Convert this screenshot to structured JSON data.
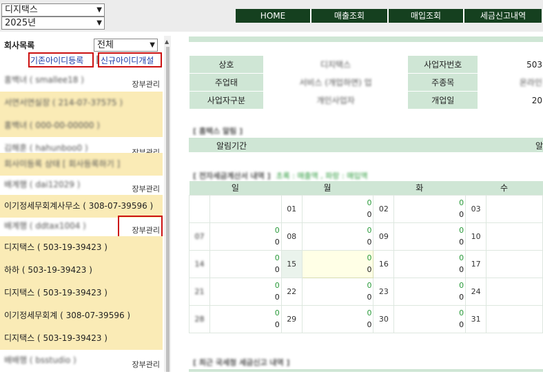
{
  "top": {
    "company_select": "디지택스",
    "year_select": "2025년",
    "nav": [
      "HOME",
      "매출조회",
      "매입조회",
      "세금신고내역"
    ]
  },
  "left": {
    "title": "회사목록",
    "filter": "전체",
    "btn_existing": "기존아이디등록",
    "sep": "|",
    "btn_new": "신규아이디개설",
    "mgmt_label": "장부관리",
    "rows": [
      "홍백녀 ( smallee18 )",
      "서연서연실장 ( 214-07-37575 )",
      "홍백녀 ( 000-00-00000 )",
      "김해훈 ( hahunboo0 )",
      "회사미등록 상태 [ 회사등록하기 ]",
      "배계행 ( dai12029 )",
      "이기정세무회계사무소 ( 308-07-39596 )",
      "배계행 ( ddtax1004 )",
      "디지택스 ( 503-19-39423 )",
      "하하 ( 503-19-39423 )",
      "디지택스 ( 503-19-39423 )",
      "이기정세무회계 ( 308-07-39596 )",
      "디지택스 ( 503-19-39423 )",
      "배배행 ( bsstudio )"
    ]
  },
  "info": {
    "labels": [
      "상호",
      "사업자번호",
      "주업태",
      "주종목",
      "사업자구분",
      "개업일"
    ],
    "values": [
      "디지택스",
      "503",
      "서비스 (개업하면) 업",
      "온라인",
      "개인사업자",
      "20"
    ]
  },
  "sections": {
    "alert": "[ 홈택스 알림 ]",
    "alert_label": "알림기간",
    "alert_right": "알",
    "einvoice": "[ 전자세금계산서 내역 ]",
    "einvoice_legend": "초록 : 매출액 , 파랑 : 매입액",
    "recent": "[ 최근 국세청 세금신고 내역 ]"
  },
  "calendar": {
    "headers": [
      "일",
      "월",
      "화",
      "수"
    ],
    "weeks": [
      [
        [
          "",
          "",
          ""
        ],
        [
          "01",
          "0",
          "0"
        ],
        [
          "02",
          "0",
          "0"
        ],
        [
          "03",
          "",
          ""
        ]
      ],
      [
        [
          "07",
          "0",
          "0"
        ],
        [
          "08",
          "0",
          "0"
        ],
        [
          "09",
          "0",
          "0"
        ],
        [
          "10",
          "",
          ""
        ]
      ],
      [
        [
          "14",
          "0",
          "0"
        ],
        [
          "15",
          "0",
          "0"
        ],
        [
          "16",
          "0",
          "0"
        ],
        [
          "17",
          "",
          ""
        ]
      ],
      [
        [
          "21",
          "0",
          "0"
        ],
        [
          "22",
          "0",
          "0"
        ],
        [
          "23",
          "0",
          "0"
        ],
        [
          "24",
          "",
          ""
        ]
      ],
      [
        [
          "28",
          "0",
          "0"
        ],
        [
          "29",
          "0",
          "0"
        ],
        [
          "30",
          "0",
          "0"
        ],
        [
          "31",
          "",
          ""
        ]
      ]
    ]
  }
}
